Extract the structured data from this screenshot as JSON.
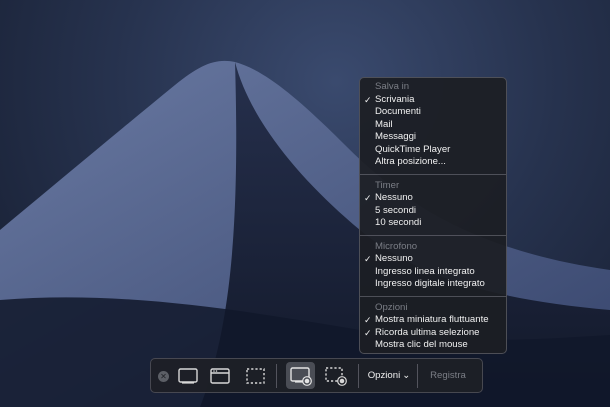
{
  "menu": {
    "sections": [
      {
        "header": "Salva in",
        "items": [
          {
            "label": "Scrivania",
            "checked": true
          },
          {
            "label": "Documenti",
            "checked": false
          },
          {
            "label": "Mail",
            "checked": false
          },
          {
            "label": "Messaggi",
            "checked": false
          },
          {
            "label": "QuickTime Player",
            "checked": false
          },
          {
            "label": "Altra posizione...",
            "checked": false
          }
        ]
      },
      {
        "header": "Timer",
        "items": [
          {
            "label": "Nessuno",
            "checked": true
          },
          {
            "label": "5 secondi",
            "checked": false
          },
          {
            "label": "10 secondi",
            "checked": false
          }
        ]
      },
      {
        "header": "Microfono",
        "items": [
          {
            "label": "Nessuno",
            "checked": true
          },
          {
            "label": "Ingresso linea integrato",
            "checked": false
          },
          {
            "label": "Ingresso digitale integrato",
            "checked": false
          }
        ]
      },
      {
        "header": "Opzioni",
        "items": [
          {
            "label": "Mostra miniatura fluttuante",
            "checked": true
          },
          {
            "label": "Ricorda ultima selezione",
            "checked": true
          },
          {
            "label": "Mostra clic del mouse",
            "checked": false
          }
        ]
      }
    ],
    "check_glyph": "✓"
  },
  "toolbar": {
    "close_glyph": "✕",
    "options_label": "Opzioni",
    "options_chevron": "⌄",
    "record_label": "Registra",
    "selected_tool": "record-selected-portion"
  },
  "colors": {
    "menu_bg": "#1c1e24",
    "header_text": "#7b7e86",
    "item_text": "#f1f1f1",
    "desktop_sky": "#27334f"
  }
}
